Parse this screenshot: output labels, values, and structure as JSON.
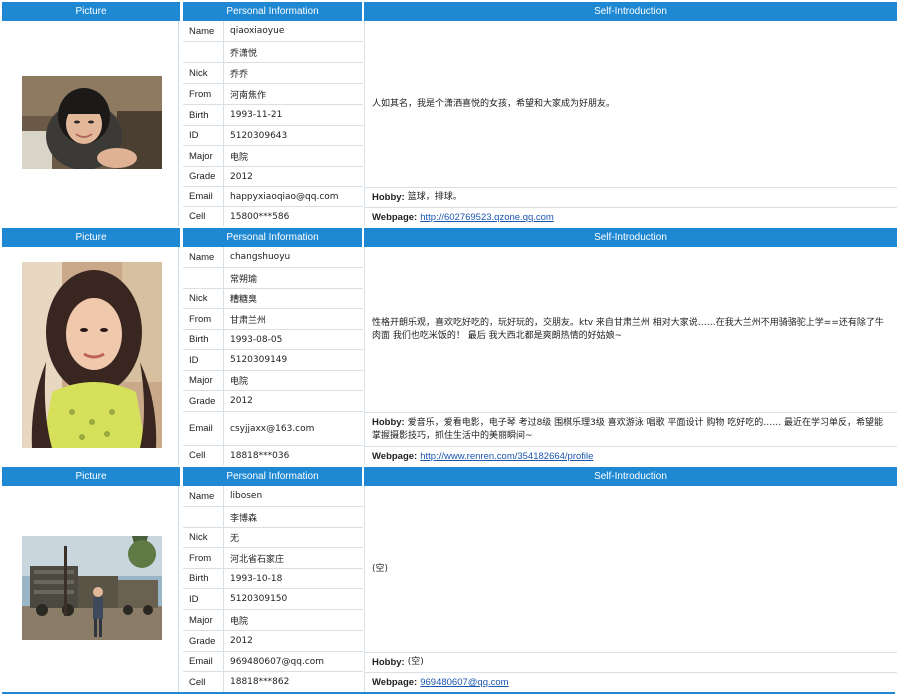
{
  "headers": {
    "picture": "Picture",
    "personal": "Personal Information",
    "intro": "Self-Introduction"
  },
  "labels": {
    "name": "Name",
    "nick": "Nick",
    "from": "From",
    "birth": "Birth",
    "id": "ID",
    "major": "Major",
    "grade": "Grade",
    "email": "Email",
    "cell": "Cell",
    "hobby": "Hobby:",
    "webpage": "Webpage:"
  },
  "people": [
    {
      "name_en": "qiaoxiaoyue",
      "name_cn": "乔潇悦",
      "nick": "乔乔",
      "from": "河南焦作",
      "birth": "1993-11-21",
      "id": "5120309643",
      "major": "电院",
      "grade": "2012",
      "email": "happyxiaoqiao@qq.com",
      "cell": "15800***586",
      "intro": "人如其名，我是个潇洒喜悦的女孩，希望和大家成为好朋友。",
      "hobby": "篮球，排球。",
      "webpage": "http://602769523.qzone.qq.com"
    },
    {
      "name_en": "changshuoyu",
      "name_cn": "常朔瑜",
      "nick": "糟糖臭",
      "from": "甘肃兰州",
      "birth": "1993-08-05",
      "id": "5120309149",
      "major": "电院",
      "grade": "2012",
      "email": "csyjjaxx@163.com",
      "cell": "18818***036",
      "intro": "性格开朗乐观，喜欢吃好吃的，玩好玩的，交朋友。ktv 来自甘肃兰州 相对大家说……在我大兰州不用骑骆驼上学==还有除了牛肉面 我们也吃米饭的！ 最后 我大西北都是爽朗热情的好姑娘~",
      "hobby": "爱音乐，爱看电影，电子琴 考过8级 围棋乐理3级 喜欢游泳 唱歌 平面设计 购物 吃好吃的…… 最近在学习单反，希望能掌握摄影技巧，抓住生活中的美丽瞬间~",
      "webpage": "http://www.renren.com/354182664/profile"
    },
    {
      "name_en": "libosen",
      "name_cn": "李博森",
      "nick": "无",
      "from": "河北省石家庄",
      "birth": "1993-10-18",
      "id": "5120309150",
      "major": "电院",
      "grade": "2012",
      "email": "969480607@qq.com",
      "cell": "18818***862",
      "intro": "(空)",
      "hobby": "(空)",
      "webpage": "969480607@qq.com"
    }
  ]
}
